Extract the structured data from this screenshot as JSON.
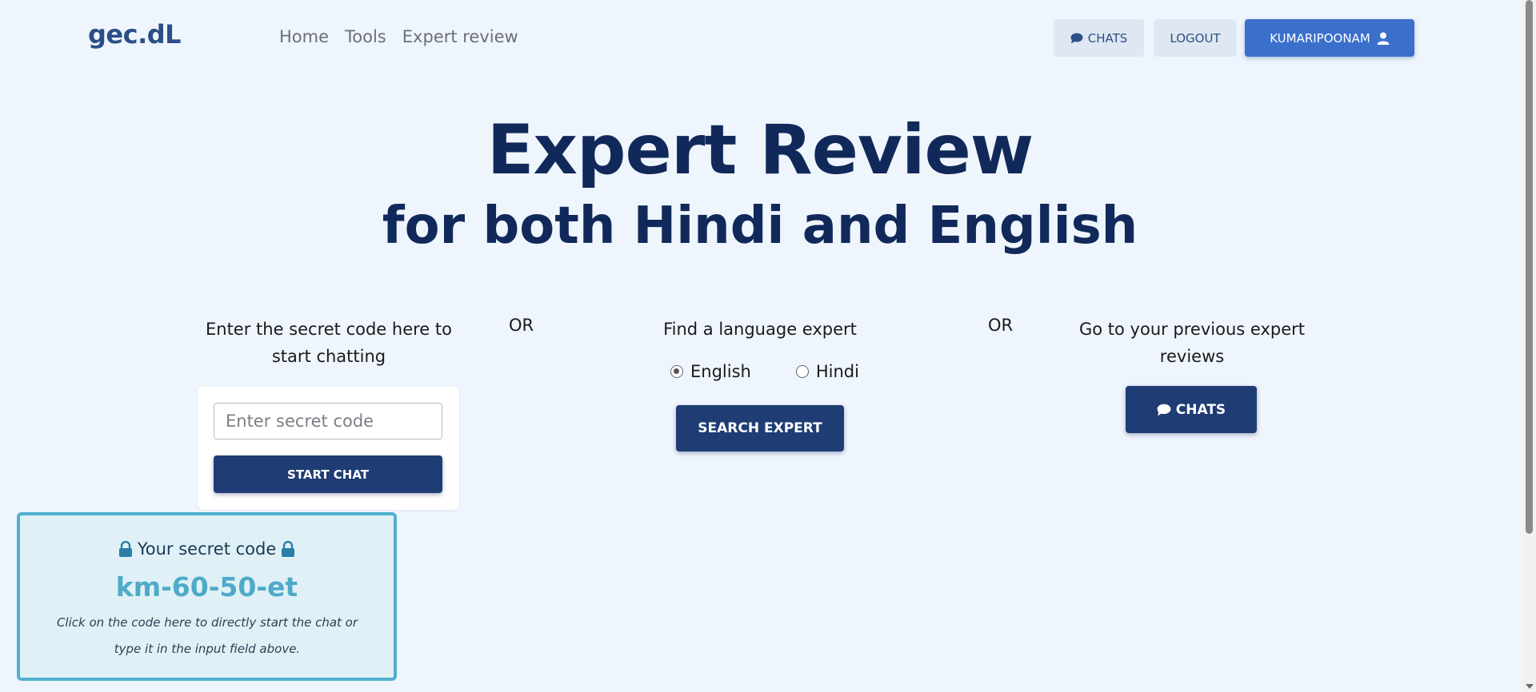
{
  "navbar": {
    "brand": "gec.dL",
    "links": [
      "Home",
      "Tools",
      "Expert review"
    ],
    "chats_label": "CHATS",
    "logout_label": "LOGOUT",
    "user_label": "KUMARIPOONAM"
  },
  "hero": {
    "title": "Expert Review",
    "subtitle": "for both Hindi and English"
  },
  "secret_section": {
    "prompt": "Enter the secret code here to start chatting",
    "input_placeholder": "Enter secret code",
    "start_label": "START CHAT"
  },
  "or_label": "OR",
  "find_section": {
    "prompt": "Find a language expert",
    "languages": [
      "English",
      "Hindi"
    ],
    "selected": "English",
    "search_label": "SEARCH EXPERT"
  },
  "previous_section": {
    "prompt": "Go to your previous expert reviews",
    "chats_label": "CHATS"
  },
  "secret_code_box": {
    "heading": "Your secret code",
    "code": "km-60-50-et",
    "note": "Click on the code here to directly start the chat or type it in the input field above."
  },
  "colors": {
    "brand": "#2b4f86",
    "primary_dark": "#1f3d74",
    "primary": "#3b6fcc",
    "hero_text": "#11295a",
    "code_accent": "#4faac8"
  },
  "icons": {
    "chat": "chat-bubble-icon",
    "user": "user-icon",
    "lock": "lock-icon"
  }
}
